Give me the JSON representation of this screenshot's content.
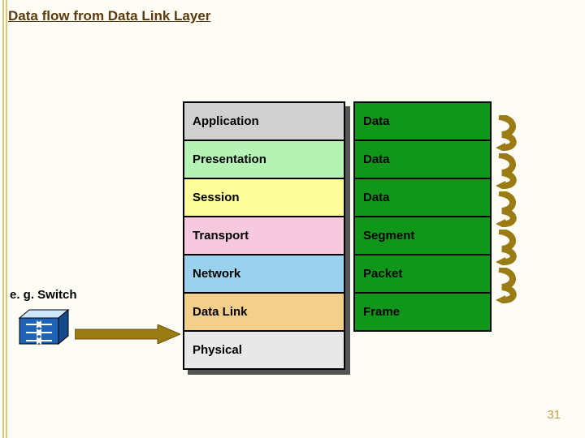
{
  "title": "Data flow from Data Link Layer",
  "side_label": "e. g. Switch",
  "osi_rows": {
    "application": "Application",
    "presentation": "Presentation",
    "session": "Session",
    "transport": "Transport",
    "network": "Network",
    "datalink": "Data Link",
    "physical": "Physical"
  },
  "pdu_rows": {
    "application": "Data",
    "presentation": "Data",
    "session": "Data",
    "transport": "Segment",
    "network": "Packet",
    "datalink": "Frame"
  },
  "page_number": "31",
  "colors": {
    "pdu_fill": "#109618",
    "arrow_fill": "#9a7b14",
    "switch_blue": "#1e63b5"
  }
}
